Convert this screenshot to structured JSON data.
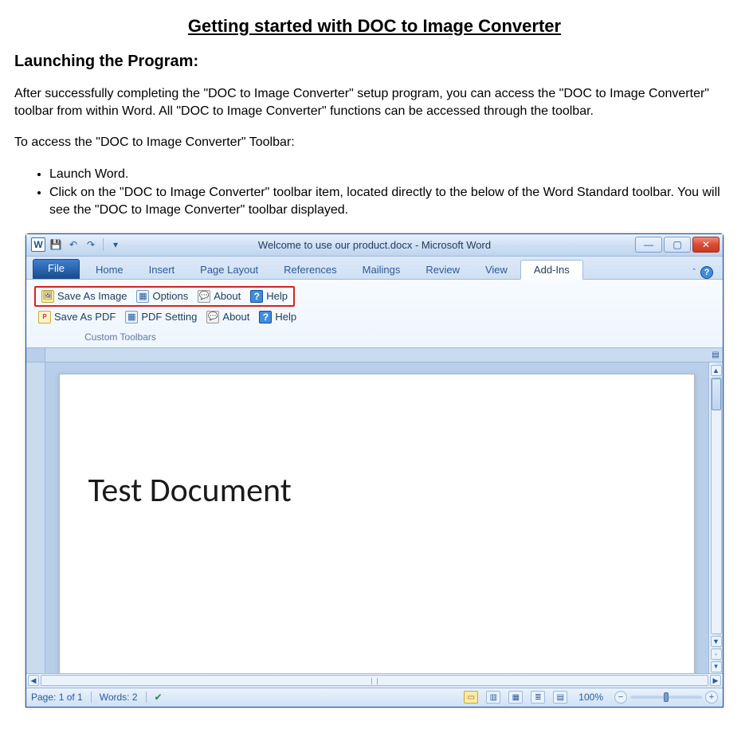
{
  "doc": {
    "title": "Getting started with DOC to Image Converter",
    "section_heading": "Launching the Program:",
    "para1": "After successfully completing the \"DOC to Image Converter\" setup program, you can access the \"DOC to Image Converter\" toolbar from within Word. All \"DOC to Image Converter\" functions can be accessed through the toolbar.",
    "para2": "To access the \"DOC to Image Converter\" Toolbar:",
    "steps": [
      "Launch Word.",
      "Click on the \"DOC to Image Converter\" toolbar item, located directly to the below of the Word Standard toolbar. You will see the \"DOC to Image Converter\" toolbar displayed."
    ]
  },
  "word": {
    "titlebar": "Welcome to use our product.docx  -  Microsoft Word",
    "tabs": {
      "file": "File",
      "home": "Home",
      "insert": "Insert",
      "page_layout": "Page Layout",
      "references": "References",
      "mailings": "Mailings",
      "review": "Review",
      "view": "View",
      "addins": "Add-Ins"
    },
    "addin_row1": {
      "save_as_image": "Save As Image",
      "options": "Options",
      "about": "About",
      "help": "Help"
    },
    "addin_row2": {
      "save_as_pdf": "Save As PDF",
      "pdf_setting": "PDF Setting",
      "about": "About",
      "help": "Help"
    },
    "group_label": "Custom Toolbars",
    "document_text": "Test Document",
    "status": {
      "page": "Page: 1 of 1",
      "words": "Words: 2",
      "zoom": "100%"
    }
  }
}
